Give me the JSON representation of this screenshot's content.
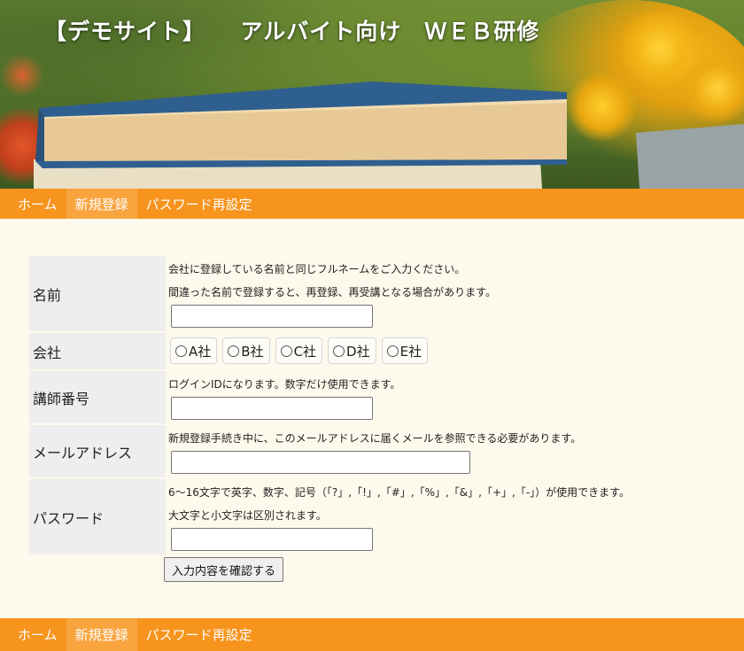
{
  "header": {
    "title": "【デモサイト】　　アルバイト向け　ＷＥＢ研修"
  },
  "nav": {
    "items": [
      {
        "label": "ホーム",
        "active": false
      },
      {
        "label": "新規登録",
        "active": true
      },
      {
        "label": "パスワード再設定",
        "active": false
      }
    ]
  },
  "form": {
    "name": {
      "label": "名前",
      "note1": "会社に登録している名前と同じフルネームをご入力ください。",
      "note2": "間違った名前で登録すると、再登録、再受講となる場合があります。",
      "value": ""
    },
    "company": {
      "label": "会社",
      "options": [
        "A社",
        "B社",
        "C社",
        "D社",
        "E社"
      ]
    },
    "instructor": {
      "label": "講師番号",
      "note": "ログインIDになります。数字だけ使用できます。",
      "value": ""
    },
    "email": {
      "label": "メールアドレス",
      "note": "新規登録手続き中に、このメールアドレスに届くメールを参照できる必要があります。",
      "value": ""
    },
    "password": {
      "label": "パスワード",
      "note1": "6～16文字で英字、数字、記号（「?」,「!」,「#」,「%」,「&」,「+」,「-」）が使用できます。",
      "note2": "大文字と小文字は区別されます。",
      "value": ""
    },
    "submit_label": "入力内容を確認する"
  },
  "colors": {
    "nav": "#f7941e",
    "nav_active": "#f9a43e",
    "page_bg": "#fdf9ec",
    "label_bg": "#eeeeee"
  }
}
